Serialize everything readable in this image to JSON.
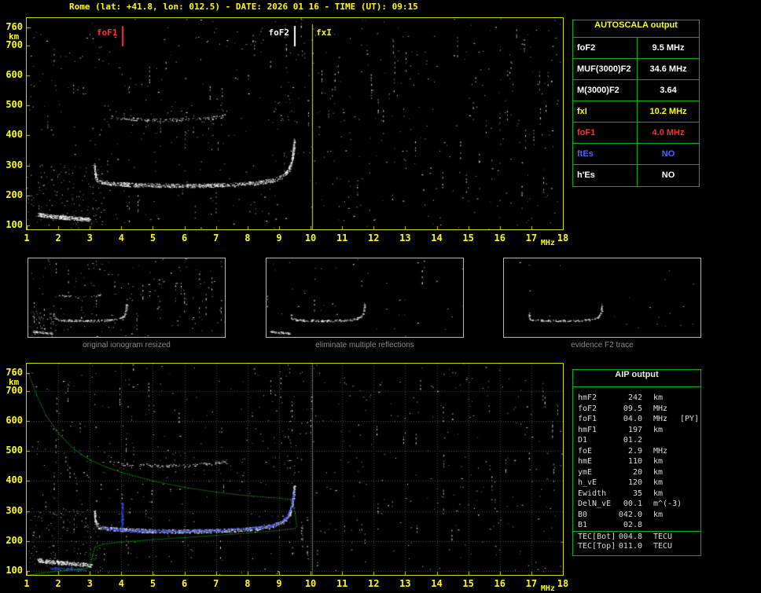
{
  "title": "Rome (lat: +41.8, lon: 012.5) - DATE: 2026 01 16 - TIME (UT): 09:15",
  "autoscala_table": {
    "header": "AUTOSCALA output",
    "rows": [
      {
        "label": "foF2",
        "value": "9.5 MHz",
        "color": "#ffffff"
      },
      {
        "label": "MUF(3000)F2",
        "value": "34.6 MHz",
        "color": "#ffffff"
      },
      {
        "label": "M(3000)F2",
        "value": "3.64",
        "color": "#ffffff"
      },
      {
        "label": "fxI",
        "value": "10.2 MHz",
        "color": "#ffff00"
      },
      {
        "label": "foF1",
        "value": "4.0 MHz",
        "color": "#ff3030"
      },
      {
        "label": "ftEs",
        "value": "NO",
        "color": "#4466ff"
      },
      {
        "label": "h'Es",
        "value": "NO",
        "color": "#ffffff"
      }
    ]
  },
  "aip_table": {
    "header": "AIP output",
    "rows": [
      {
        "name": "hmF2",
        "value": "242",
        "unit": "km",
        "extra": ""
      },
      {
        "name": "foF2",
        "value": "09.5",
        "unit": "MHz",
        "extra": ""
      },
      {
        "name": "foF1",
        "value": "04.0",
        "unit": "MHz",
        "extra": "[PY]"
      },
      {
        "name": "hmF1",
        "value": "197",
        "unit": "km",
        "extra": ""
      },
      {
        "name": "D1",
        "value": "01.2",
        "unit": "",
        "extra": ""
      },
      {
        "name": "foE",
        "value": "2.9",
        "unit": "MHz",
        "extra": ""
      },
      {
        "name": "hmE",
        "value": "110",
        "unit": "km",
        "extra": ""
      },
      {
        "name": "ymE",
        "value": "20",
        "unit": "km",
        "extra": ""
      },
      {
        "name": "h_vE",
        "value": "120",
        "unit": "km",
        "extra": ""
      },
      {
        "name": "Ewidth",
        "value": "35",
        "unit": "km",
        "extra": ""
      },
      {
        "name": "DelN_vE",
        "value": "00.1",
        "unit": "m^(-3)",
        "extra": ""
      },
      {
        "name": "B0",
        "value": "042.0",
        "unit": "km",
        "extra": ""
      },
      {
        "name": "B1",
        "value": "02.8",
        "unit": "",
        "extra": ""
      },
      {
        "name": "TEC[Bot]",
        "value": "004.8",
        "unit": "TECU",
        "extra": "",
        "divider": true
      },
      {
        "name": "TEC[Top]",
        "value": "011.0",
        "unit": "TECU",
        "extra": ""
      }
    ]
  },
  "thumbnails": [
    {
      "caption": "original ionogram resized"
    },
    {
      "caption": "eliminate multiple reflections"
    },
    {
      "caption": "evidence F2 trace"
    }
  ],
  "chart_data": {
    "type": "scatter",
    "title": "Rome ionogram 2026-01-16 09:15 UT, scaled by AUTOSCALA (top) and AIP inversion (bottom)",
    "xlabel": "MHz",
    "ylabel": "km",
    "x_ticks": [
      1,
      2,
      3,
      4,
      5,
      6,
      7,
      8,
      9,
      10,
      11,
      12,
      13,
      14,
      15,
      16,
      17,
      18
    ],
    "y_ticks": [
      100,
      200,
      300,
      400,
      500,
      600,
      700,
      760
    ],
    "axes": {
      "fmin": 1,
      "fmax": 18,
      "kmin": 87,
      "kmax": 791
    },
    "markers": [
      {
        "label": "foF1",
        "f": 4.05,
        "color": "#ff3030",
        "label_side": "left",
        "full": false
      },
      {
        "label": "foF2",
        "f": 9.5,
        "color": "#ffffff",
        "label_side": "left",
        "full": false
      },
      {
        "label": "fxI",
        "f": 10.05,
        "color": "#ffff00",
        "label_side": "right",
        "full": true
      }
    ],
    "traces": {
      "f_trace": {
        "points": [
          [
            3.14,
            302
          ],
          [
            3.17,
            262
          ],
          [
            3.25,
            247
          ],
          [
            3.6,
            241
          ],
          [
            4.3,
            236
          ],
          [
            5.5,
            233
          ],
          [
            6.5,
            233
          ],
          [
            7.5,
            236
          ],
          [
            8.3,
            242
          ],
          [
            8.8,
            251
          ],
          [
            9.1,
            264
          ],
          [
            9.3,
            286
          ],
          [
            9.4,
            315
          ],
          [
            9.45,
            350
          ],
          [
            9.48,
            385
          ]
        ],
        "thickness": 5,
        "density": 3.2,
        "color": "#ffffff"
      },
      "es_trace": {
        "points": [
          [
            1.35,
            137
          ],
          [
            1.8,
            130
          ],
          [
            2.3,
            126
          ],
          [
            2.8,
            122
          ],
          [
            3.05,
            119
          ]
        ],
        "thickness": 5,
        "density": 5,
        "color": "#ffffff"
      },
      "second_hop": {
        "points": [
          [
            3.6,
            462
          ],
          [
            4.3,
            455
          ],
          [
            5.2,
            451
          ],
          [
            6.0,
            453
          ],
          [
            6.8,
            458
          ],
          [
            7.3,
            466
          ]
        ],
        "thickness": 4,
        "density": 0.9,
        "color": "#ffffff"
      },
      "blue_fit": {
        "points": [
          [
            3.3,
            250
          ],
          [
            3.7,
            241
          ],
          [
            4.1,
            236
          ],
          [
            5.0,
            234
          ],
          [
            6.0,
            234
          ],
          [
            7.0,
            236
          ],
          [
            8.0,
            242
          ],
          [
            8.7,
            251
          ],
          [
            9.1,
            265
          ],
          [
            9.3,
            290
          ],
          [
            9.42,
            330
          ],
          [
            9.47,
            365
          ]
        ],
        "thickness": 3,
        "density": 2.5,
        "color": "#3b55ff"
      },
      "blue_cusp": {
        "points": [
          [
            4.02,
            238
          ],
          [
            4.02,
            325
          ]
        ],
        "thickness": 3,
        "density": 3,
        "color": "#3b55ff"
      },
      "blue_e": {
        "points": [
          [
            1.75,
            110
          ],
          [
            2.3,
            107
          ],
          [
            2.85,
            105
          ]
        ],
        "thickness": 3,
        "density": 2,
        "color": "#3b55ff"
      }
    },
    "curves": {
      "profile_top": {
        "points": [
          [
            1.05,
            758
          ],
          [
            1.3,
            688
          ],
          [
            1.6,
            620
          ],
          [
            2.0,
            560
          ],
          [
            2.5,
            506
          ],
          [
            3.0,
            471
          ],
          [
            3.5,
            448
          ],
          [
            4.0,
            430
          ],
          [
            5.0,
            401
          ],
          [
            6.0,
            380
          ],
          [
            7.0,
            364
          ],
          [
            8.0,
            352
          ],
          [
            9.0,
            344
          ],
          [
            9.35,
            340
          ],
          [
            9.5,
            295
          ],
          [
            9.55,
            248
          ]
        ],
        "color": "#00cc00",
        "step": 2,
        "size": 1
      },
      "profile_bottom": {
        "points": [
          [
            1.05,
            88
          ],
          [
            1.5,
            95
          ],
          [
            2.0,
            101
          ],
          [
            2.5,
            106
          ],
          [
            2.9,
            111
          ],
          [
            3.0,
            118
          ],
          [
            3.08,
            155
          ],
          [
            3.15,
            180
          ],
          [
            3.4,
            191
          ],
          [
            4.0,
            198
          ],
          [
            5.0,
            206
          ],
          [
            6.0,
            213
          ],
          [
            7.0,
            220
          ],
          [
            8.0,
            228
          ],
          [
            9.0,
            237
          ],
          [
            9.5,
            243
          ]
        ],
        "color": "#00cc00",
        "step": 2,
        "size": 1
      }
    }
  }
}
